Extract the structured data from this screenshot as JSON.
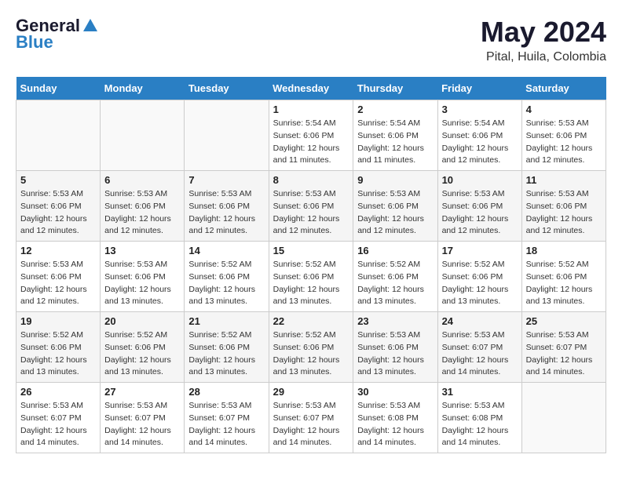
{
  "header": {
    "logo_line1": "General",
    "logo_line2": "Blue",
    "month_year": "May 2024",
    "location": "Pital, Huila, Colombia"
  },
  "days_of_week": [
    "Sunday",
    "Monday",
    "Tuesday",
    "Wednesday",
    "Thursday",
    "Friday",
    "Saturday"
  ],
  "weeks": [
    [
      {
        "day": "",
        "info": ""
      },
      {
        "day": "",
        "info": ""
      },
      {
        "day": "",
        "info": ""
      },
      {
        "day": "1",
        "info": "Sunrise: 5:54 AM\nSunset: 6:06 PM\nDaylight: 12 hours\nand 11 minutes."
      },
      {
        "day": "2",
        "info": "Sunrise: 5:54 AM\nSunset: 6:06 PM\nDaylight: 12 hours\nand 11 minutes."
      },
      {
        "day": "3",
        "info": "Sunrise: 5:54 AM\nSunset: 6:06 PM\nDaylight: 12 hours\nand 12 minutes."
      },
      {
        "day": "4",
        "info": "Sunrise: 5:53 AM\nSunset: 6:06 PM\nDaylight: 12 hours\nand 12 minutes."
      }
    ],
    [
      {
        "day": "5",
        "info": "Sunrise: 5:53 AM\nSunset: 6:06 PM\nDaylight: 12 hours\nand 12 minutes."
      },
      {
        "day": "6",
        "info": "Sunrise: 5:53 AM\nSunset: 6:06 PM\nDaylight: 12 hours\nand 12 minutes."
      },
      {
        "day": "7",
        "info": "Sunrise: 5:53 AM\nSunset: 6:06 PM\nDaylight: 12 hours\nand 12 minutes."
      },
      {
        "day": "8",
        "info": "Sunrise: 5:53 AM\nSunset: 6:06 PM\nDaylight: 12 hours\nand 12 minutes."
      },
      {
        "day": "9",
        "info": "Sunrise: 5:53 AM\nSunset: 6:06 PM\nDaylight: 12 hours\nand 12 minutes."
      },
      {
        "day": "10",
        "info": "Sunrise: 5:53 AM\nSunset: 6:06 PM\nDaylight: 12 hours\nand 12 minutes."
      },
      {
        "day": "11",
        "info": "Sunrise: 5:53 AM\nSunset: 6:06 PM\nDaylight: 12 hours\nand 12 minutes."
      }
    ],
    [
      {
        "day": "12",
        "info": "Sunrise: 5:53 AM\nSunset: 6:06 PM\nDaylight: 12 hours\nand 12 minutes."
      },
      {
        "day": "13",
        "info": "Sunrise: 5:53 AM\nSunset: 6:06 PM\nDaylight: 12 hours\nand 13 minutes."
      },
      {
        "day": "14",
        "info": "Sunrise: 5:52 AM\nSunset: 6:06 PM\nDaylight: 12 hours\nand 13 minutes."
      },
      {
        "day": "15",
        "info": "Sunrise: 5:52 AM\nSunset: 6:06 PM\nDaylight: 12 hours\nand 13 minutes."
      },
      {
        "day": "16",
        "info": "Sunrise: 5:52 AM\nSunset: 6:06 PM\nDaylight: 12 hours\nand 13 minutes."
      },
      {
        "day": "17",
        "info": "Sunrise: 5:52 AM\nSunset: 6:06 PM\nDaylight: 12 hours\nand 13 minutes."
      },
      {
        "day": "18",
        "info": "Sunrise: 5:52 AM\nSunset: 6:06 PM\nDaylight: 12 hours\nand 13 minutes."
      }
    ],
    [
      {
        "day": "19",
        "info": "Sunrise: 5:52 AM\nSunset: 6:06 PM\nDaylight: 12 hours\nand 13 minutes."
      },
      {
        "day": "20",
        "info": "Sunrise: 5:52 AM\nSunset: 6:06 PM\nDaylight: 12 hours\nand 13 minutes."
      },
      {
        "day": "21",
        "info": "Sunrise: 5:52 AM\nSunset: 6:06 PM\nDaylight: 12 hours\nand 13 minutes."
      },
      {
        "day": "22",
        "info": "Sunrise: 5:52 AM\nSunset: 6:06 PM\nDaylight: 12 hours\nand 13 minutes."
      },
      {
        "day": "23",
        "info": "Sunrise: 5:53 AM\nSunset: 6:06 PM\nDaylight: 12 hours\nand 13 minutes."
      },
      {
        "day": "24",
        "info": "Sunrise: 5:53 AM\nSunset: 6:07 PM\nDaylight: 12 hours\nand 14 minutes."
      },
      {
        "day": "25",
        "info": "Sunrise: 5:53 AM\nSunset: 6:07 PM\nDaylight: 12 hours\nand 14 minutes."
      }
    ],
    [
      {
        "day": "26",
        "info": "Sunrise: 5:53 AM\nSunset: 6:07 PM\nDaylight: 12 hours\nand 14 minutes."
      },
      {
        "day": "27",
        "info": "Sunrise: 5:53 AM\nSunset: 6:07 PM\nDaylight: 12 hours\nand 14 minutes."
      },
      {
        "day": "28",
        "info": "Sunrise: 5:53 AM\nSunset: 6:07 PM\nDaylight: 12 hours\nand 14 minutes."
      },
      {
        "day": "29",
        "info": "Sunrise: 5:53 AM\nSunset: 6:07 PM\nDaylight: 12 hours\nand 14 minutes."
      },
      {
        "day": "30",
        "info": "Sunrise: 5:53 AM\nSunset: 6:08 PM\nDaylight: 12 hours\nand 14 minutes."
      },
      {
        "day": "31",
        "info": "Sunrise: 5:53 AM\nSunset: 6:08 PM\nDaylight: 12 hours\nand 14 minutes."
      },
      {
        "day": "",
        "info": ""
      }
    ]
  ]
}
